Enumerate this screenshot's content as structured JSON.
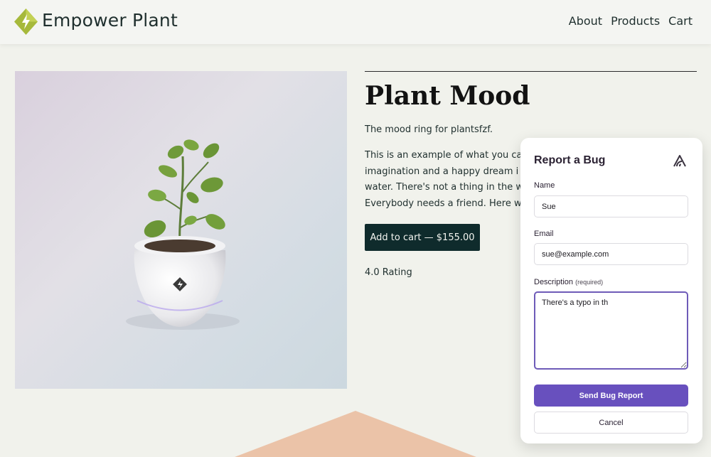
{
  "header": {
    "brand": "Empower Plant",
    "nav": [
      "About",
      "Products",
      "Cart"
    ]
  },
  "product": {
    "title": "Plant Mood",
    "tagline": "The mood ring for plantsfzf.",
    "description_lines": [
      "This is an example of what you car",
      "imagination and a happy dream i",
      "water. There's not a thing in the wo",
      "Everybody needs a friend. Here we"
    ],
    "add_to_cart": "Add to cart — $155.00",
    "rating": "4.0 Rating"
  },
  "bug_report": {
    "title": "Report a Bug",
    "name_label": "Name",
    "name_value": "Sue",
    "email_label": "Email",
    "email_value": "sue@example.com",
    "description_label": "Description",
    "description_required": "(required)",
    "description_value": "There's a typo in th",
    "send_label": "Send Bug Report",
    "cancel_label": "Cancel"
  },
  "icons": {
    "brand_logo": "lightning-diamond-icon",
    "dialog_logo": "sentry-icon"
  },
  "colors": {
    "page_bg": "#f1f2ec",
    "primary_dark": "#0f2b2c",
    "brand_green": "#a6b93b",
    "bug_accent": "#6850be",
    "decor_peach": "#ebc3a8"
  }
}
